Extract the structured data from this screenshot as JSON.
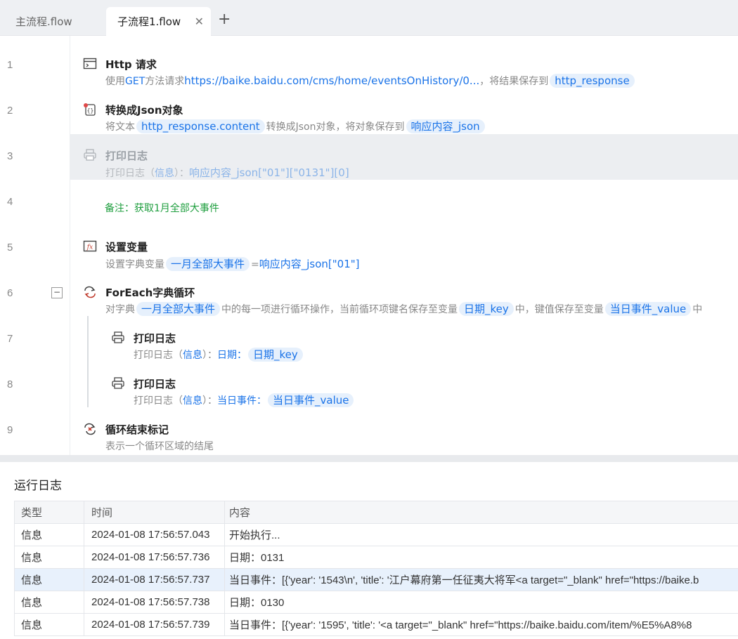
{
  "tabs": {
    "main": "主流程.flow",
    "sub": "子流程1.flow",
    "close_glyph": "✕",
    "add_glyph": "+"
  },
  "line_numbers": [
    "1",
    "2",
    "3",
    "4",
    "5",
    "6",
    "7",
    "8",
    "9"
  ],
  "collapse_glyph": "−",
  "rows": [
    {
      "title": "Http 请求",
      "icon": "browser-window-icon",
      "desc_prefix": "使用",
      "method": "GET",
      "desc_mid": "方法请求",
      "url": "https://baike.baidu.com/cms/home/eventsOnHistory/0...",
      "desc_suffix": "，将结果保存到",
      "var": "http_response"
    },
    {
      "title": "转换成Json对象",
      "icon": "json-convert-icon",
      "desc_prefix": "将文本",
      "var_in": "http_response.content",
      "desc_mid": "转换成Json对象，将对象保存到",
      "var": "响应内容_json"
    },
    {
      "title": "打印日志",
      "icon": "printer-icon",
      "desc_prefix": "打印日志（",
      "level": "信息",
      "desc_mid": "）：",
      "expr": "响应内容_json[\"01\"][\"0131\"][0]"
    },
    {
      "comment": "备注：获取1月全部大事件"
    },
    {
      "title": "设置变量",
      "icon": "variable-icon",
      "desc_prefix": "设置字典变量",
      "var": "一月全部大事件",
      "desc_mid": "=",
      "expr": "响应内容_json[\"01\"]"
    },
    {
      "title": "ForEach字典循环",
      "icon": "loop-icon",
      "desc_prefix": "对字典",
      "var_dict": "一月全部大事件",
      "desc_mid": "中的每一项进行循环操作，当前循环项键名保存至变量",
      "var_key": "日期_key",
      "desc_mid2": "中，键值保存至变量",
      "var_value": "当日事件_value",
      "desc_suffix": "中"
    },
    {
      "title": "打印日志",
      "icon": "printer-icon",
      "desc_prefix": "打印日志（",
      "level": "信息",
      "desc_mid": "）：",
      "label": "日期：",
      "var": "日期_key"
    },
    {
      "title": "打印日志",
      "icon": "printer-icon",
      "desc_prefix": "打印日志（",
      "level": "信息",
      "desc_mid": "）：",
      "label": "当日事件：",
      "var": "当日事件_value"
    },
    {
      "title": "循环结束标记",
      "icon": "loop-end-icon",
      "desc_prefix": "表示一个循环区域的结尾"
    }
  ],
  "log": {
    "title": "运行日志",
    "headers": [
      "类型",
      "时间",
      "内容"
    ],
    "rows": [
      {
        "type": "信息",
        "time": "2024-01-08 17:56:57.043",
        "content": "开始执行..."
      },
      {
        "type": "信息",
        "time": "2024-01-08 17:56:57.736",
        "content": "日期：0131"
      },
      {
        "type": "信息",
        "time": "2024-01-08 17:56:57.737",
        "content": "当日事件：[{'year': '1543\\n', 'title': '江户幕府第一任征夷大将军<a target=\"_blank\" href=\"https://baike.b"
      },
      {
        "type": "信息",
        "time": "2024-01-08 17:56:57.738",
        "content": "日期：0130"
      },
      {
        "type": "信息",
        "time": "2024-01-08 17:56:57.739",
        "content": "当日事件：[{'year': '1595', 'title': '<a target=\"_blank\" href=\"https://baike.baidu.com/item/%E5%A8%8"
      }
    ]
  },
  "colors": {
    "accent": "#1a73e8",
    "comment": "#1e9e3e",
    "selected_row": "#eceef1",
    "highlight_log": "#e8f1fc"
  }
}
